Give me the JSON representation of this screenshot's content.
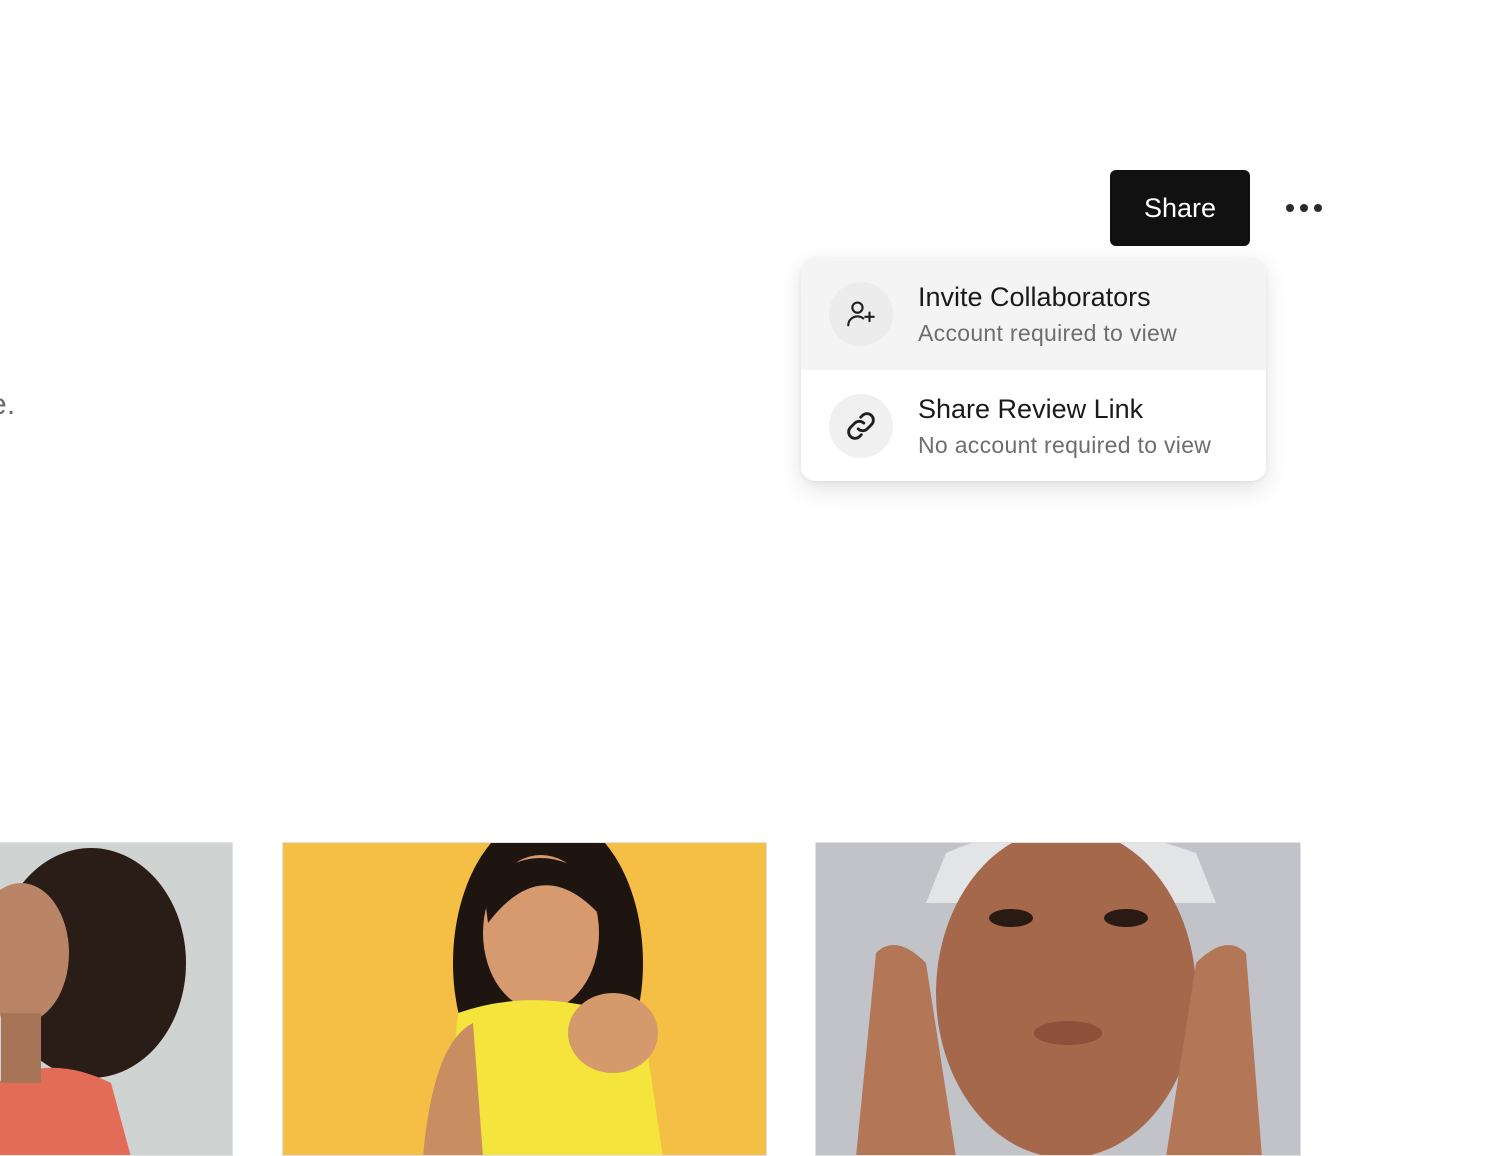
{
  "main": {
    "description_fragment": "iend role."
  },
  "header": {
    "share_label": "Share",
    "more_icon": "more-horizontal-icon"
  },
  "share_menu": {
    "items": [
      {
        "icon": "user-plus-icon",
        "title": "Invite Collaborators",
        "subtitle": "Account required to view",
        "hovered": true
      },
      {
        "icon": "link-icon",
        "title": "Share Review Link",
        "subtitle": "No account required to view",
        "hovered": false
      }
    ]
  },
  "gallery": {
    "images": [
      {
        "name": "photo-woman-curly-hair",
        "background": "#cfd2d0"
      },
      {
        "name": "photo-woman-yellow-top",
        "background": "#f4be45"
      },
      {
        "name": "photo-woman-skincare",
        "background": "#bfc0c6"
      }
    ]
  },
  "colors": {
    "primary_button_bg": "#111111",
    "primary_button_text": "#ffffff",
    "menu_hover_bg": "#f4f4f4",
    "secondary_text": "#6e6e6e"
  }
}
